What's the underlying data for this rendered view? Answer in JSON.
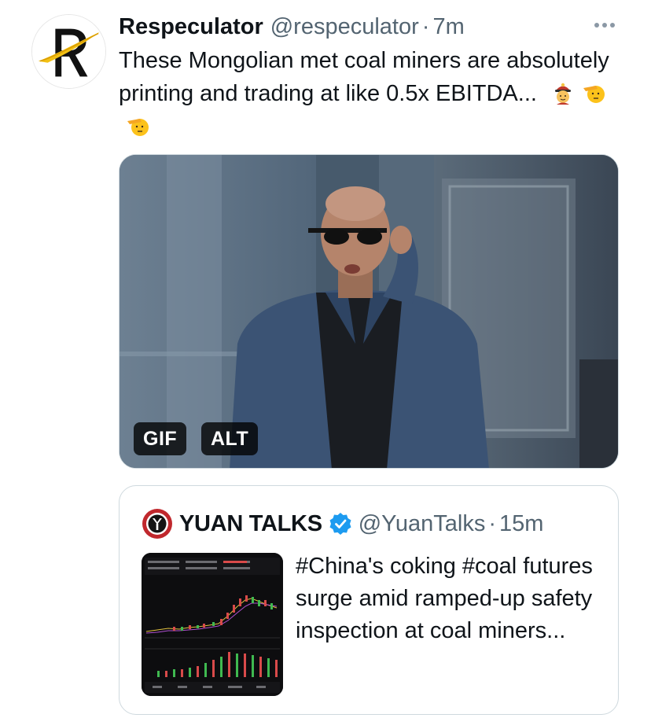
{
  "tweet": {
    "author_name": "Respeculator",
    "author_handle": "@respeculator",
    "separator": "·",
    "timestamp": "7m",
    "text": "These Mongolian met coal miners are absolutely printing and trading at like 0.5x EBITDA...",
    "emojis": [
      "man-with-chinese-cap-emoji",
      "saluting-face-emoji",
      "saluting-face-emoji"
    ],
    "media": {
      "type": "gif",
      "gif_badge": "GIF",
      "alt_badge": "ALT"
    }
  },
  "quoted_tweet": {
    "author_name": "YUAN TALKS",
    "verified": true,
    "author_handle": "@YuanTalks",
    "separator": "·",
    "timestamp": "15m",
    "text": "#China's coking #coal futures surge amid ramped-up safety inspection at coal miners..."
  },
  "colors": {
    "text_primary": "#0f1419",
    "text_secondary": "#536471",
    "border": "#cfd9de",
    "verified_blue": "#1d9bf0"
  }
}
